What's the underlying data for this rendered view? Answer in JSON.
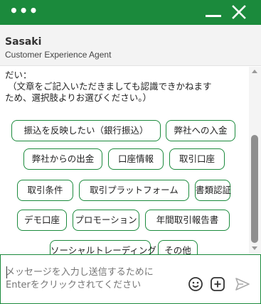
{
  "header": {
    "menu_icon": "ellipsis-icon",
    "minimize_icon": "minimize-icon",
    "close_icon": "close-icon",
    "bg_color": "#1b8a3c"
  },
  "agent": {
    "name": "Sasaki",
    "role": "Customer Experience Agent"
  },
  "message": {
    "text": "だい：\n （文章をご記入いただきましても認識できかねます\nため、選択肢よりお選びください。）"
  },
  "options": [
    "振込を反映したい（銀行振込）",
    "弊社への入金",
    "弊社からの出金",
    "口座情報",
    "取引口座",
    "取引条件",
    "取引プラットフォーム",
    "書類認証",
    "デモ口座",
    "プロモーション",
    "年間取引報告書",
    "ソーシャルトレーディング",
    "その他"
  ],
  "composer": {
    "placeholder": "メッセージを入力し送信するために\nEnterをクリックされてください",
    "emoji_icon": "emoji-icon",
    "attach_icon": "plus-box-icon",
    "send_icon": "send-icon"
  }
}
